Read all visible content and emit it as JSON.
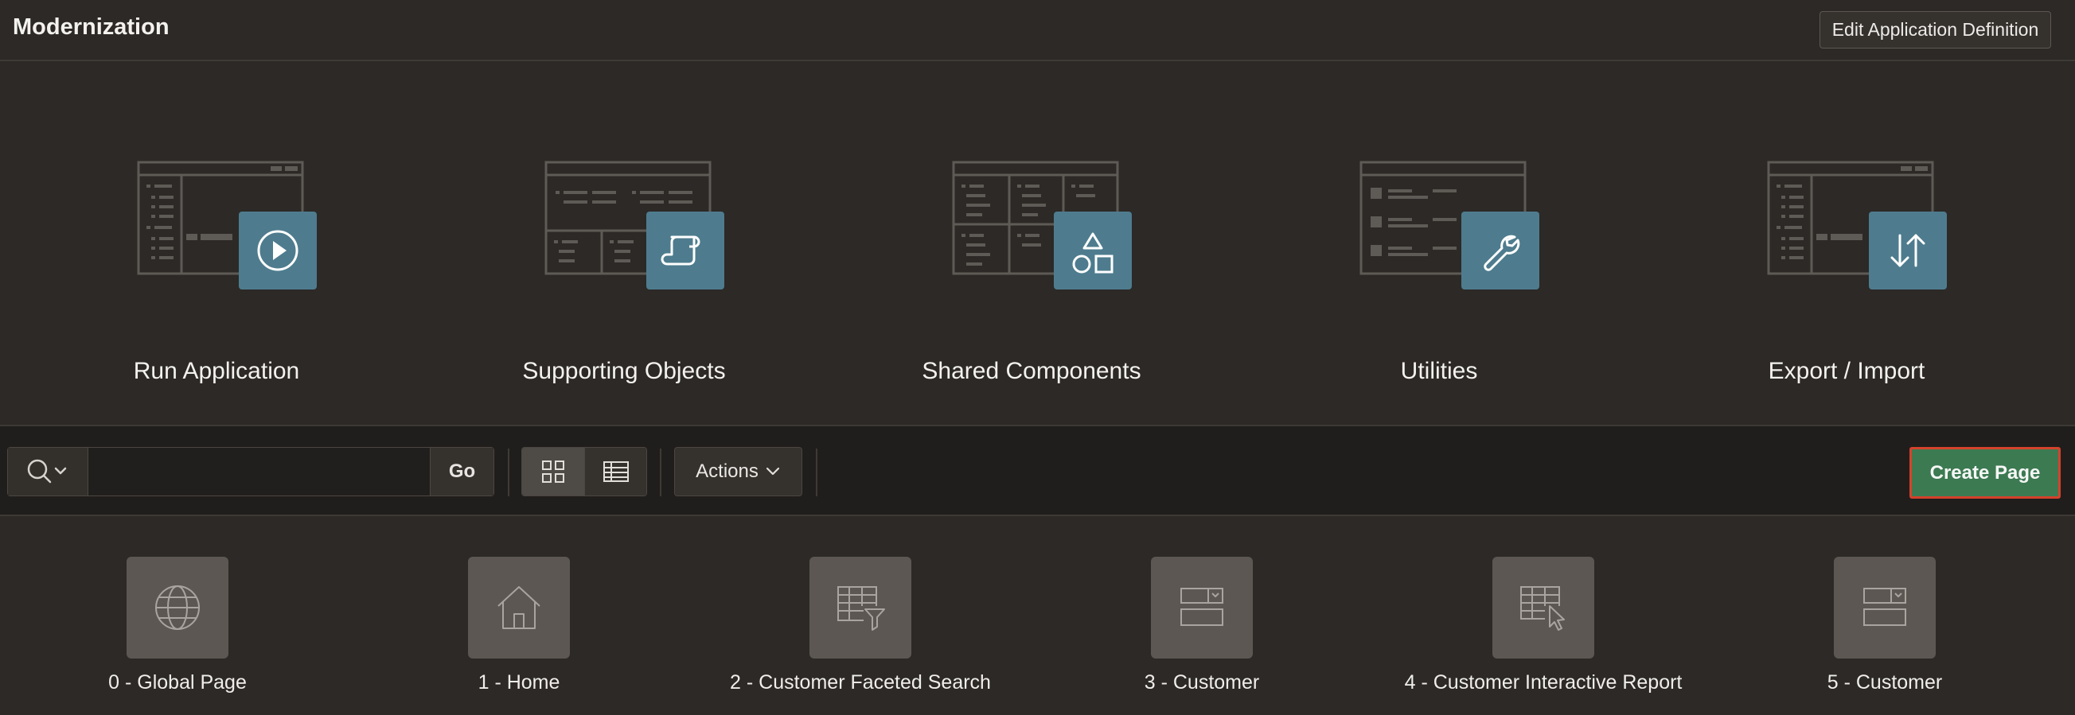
{
  "app": {
    "title": "Modernization",
    "edit_definition_label": "Edit Application Definition"
  },
  "tiles": [
    {
      "label": "Run Application",
      "icon": "play-icon"
    },
    {
      "label": "Supporting Objects",
      "icon": "scroll-icon"
    },
    {
      "label": "Shared Components",
      "icon": "shapes-icon"
    },
    {
      "label": "Utilities",
      "icon": "wrench-icon"
    },
    {
      "label": "Export / Import",
      "icon": "up-down-arrows-icon"
    }
  ],
  "toolbar": {
    "search_placeholder": "",
    "go_label": "Go",
    "actions_label": "Actions",
    "create_page_label": "Create Page",
    "view_mode": "grid"
  },
  "pages": [
    {
      "label": "0 - Global Page",
      "icon": "globe-icon"
    },
    {
      "label": "1 - Home",
      "icon": "home-icon"
    },
    {
      "label": "2 - Customer Faceted Search",
      "icon": "faceted-search-icon"
    },
    {
      "label": "3 - Customer",
      "icon": "form-icon"
    },
    {
      "label": "4 - Customer Interactive Report",
      "icon": "interactive-report-icon"
    },
    {
      "label": "5 - Customer",
      "icon": "form-icon"
    }
  ],
  "colors": {
    "background": "#2c2926",
    "toolbar": "#201e1c",
    "tile_accent": "#4e7c8e",
    "create_button": "#3c7a52",
    "highlight_border": "#d4422c"
  }
}
